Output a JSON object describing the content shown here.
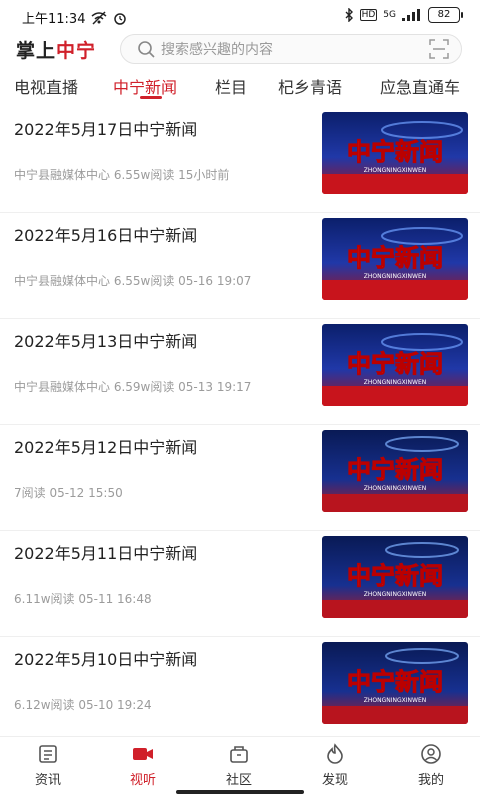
{
  "status": {
    "time": "上午11:34",
    "battery": "82",
    "signal": "5G"
  },
  "header": {
    "logo_black": "掌上",
    "logo_red": "中宁",
    "search_placeholder": "搜索感兴趣的内容"
  },
  "tabs": [
    {
      "label": "电视直播",
      "active": false
    },
    {
      "label": "中宁新闻",
      "active": true
    },
    {
      "label": "栏目",
      "active": false
    },
    {
      "label": "杞乡青语",
      "active": false
    },
    {
      "label": "应急直通车",
      "active": false
    }
  ],
  "news": [
    {
      "title": "2022年5月17日中宁新闻",
      "meta": "中宁县融媒体中心   6.55w阅读   15小时前"
    },
    {
      "title": "2022年5月16日中宁新闻",
      "meta": "中宁县融媒体中心   6.55w阅读   05-16 19:07"
    },
    {
      "title": "2022年5月13日中宁新闻",
      "meta": "中宁县融媒体中心   6.59w阅读   05-13 19:17"
    },
    {
      "title": "2022年5月12日中宁新闻",
      "meta": "7阅读   05-12 15:50"
    },
    {
      "title": "2022年5月11日中宁新闻",
      "meta": "6.11w阅读   05-11 16:48"
    },
    {
      "title": "2022年5月10日中宁新闻",
      "meta": "6.12w阅读   05-10 19:24"
    }
  ],
  "thumb": {
    "main_text": "中宁新闻",
    "sub_text": "ZHONGNINGXINWEN"
  },
  "bottom_nav": [
    {
      "label": "资讯",
      "icon": "news-icon",
      "active": false
    },
    {
      "label": "视听",
      "icon": "video-icon",
      "active": true
    },
    {
      "label": "社区",
      "icon": "community-icon",
      "active": false
    },
    {
      "label": "发现",
      "icon": "discover-icon",
      "active": false
    },
    {
      "label": "我的",
      "icon": "profile-icon",
      "active": false
    }
  ],
  "colors": {
    "accent": "#d0202a"
  }
}
